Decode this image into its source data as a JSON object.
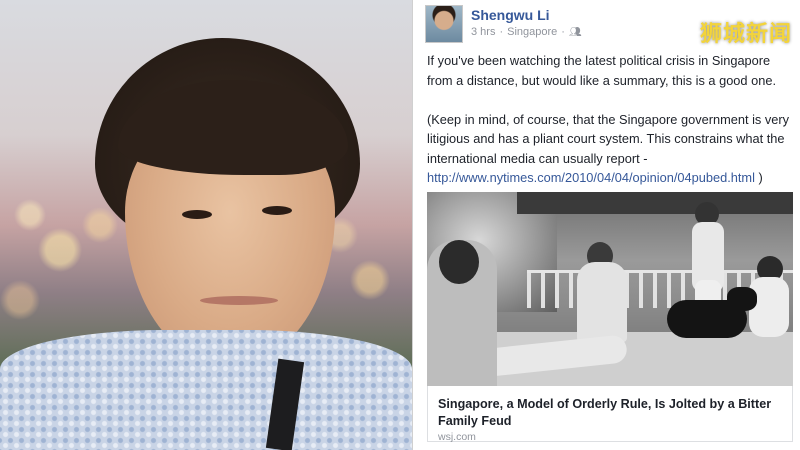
{
  "post": {
    "author": "Shengwu Li",
    "time": "3 hrs",
    "location": "Singapore",
    "audience_icon": "people-icon",
    "paragraph1": "If you've been watching the latest political crisis in Singapore from a distance, but would like a summary, this is a good one.",
    "paragraph2_text": "(Keep in mind, of course, that the Singapore government is very litigious and has a pliant court system.  This constrains what the international media can usually report - ",
    "paragraph2_link": "http://www.nytimes.com/2010/04/04/opinion/04pubed.html",
    "paragraph2_end": " )"
  },
  "link_card": {
    "title": "Singapore, a Model of Orderly Rule, Is Jolted by a Bitter Family Feud",
    "source": "wsj.com"
  },
  "watermark": "狮城新闻",
  "colors": {
    "author_blue": "#365899",
    "meta_grey": "#90949c",
    "watermark_yellow": "#f3d43a"
  }
}
